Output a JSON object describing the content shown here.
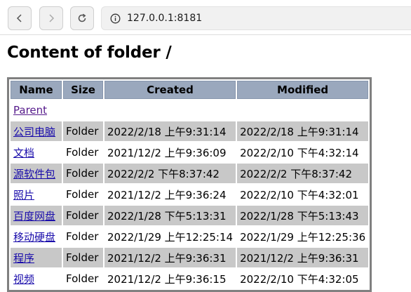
{
  "browser": {
    "url": "127.0.0.1:8181"
  },
  "page": {
    "title": "Content of folder /"
  },
  "table": {
    "headers": {
      "name": "Name",
      "size": "Size",
      "created": "Created",
      "modified": "Modified"
    },
    "parent_link": "Parent",
    "rows": [
      {
        "name": "公司电脑",
        "size": "Folder",
        "created": "2022/2/18 上午9:31:14",
        "modified": "2022/2/18 上午9:31:14"
      },
      {
        "name": "文档",
        "size": "Folder",
        "created": "2021/12/2 上午9:36:09",
        "modified": "2022/2/10 下午4:32:14"
      },
      {
        "name": "源软件包",
        "size": "Folder",
        "created": "2022/2/2 下午8:37:42",
        "modified": "2022/2/2 下午8:37:42"
      },
      {
        "name": "照片",
        "size": "Folder",
        "created": "2021/12/2 上午9:36:24",
        "modified": "2022/2/10 下午4:32:01"
      },
      {
        "name": "百度网盘",
        "size": "Folder",
        "created": "2022/1/28 下午5:13:31",
        "modified": "2022/1/28 下午5:13:43"
      },
      {
        "name": "移动硬盘",
        "size": "Folder",
        "created": "2022/1/29 上午12:25:14",
        "modified": "2022/1/29 上午12:25:36"
      },
      {
        "name": "程序",
        "size": "Folder",
        "created": "2021/12/2 上午9:36:31",
        "modified": "2021/12/2 上午9:36:31"
      },
      {
        "name": "视频",
        "size": "Folder",
        "created": "2021/12/2 上午9:36:15",
        "modified": "2022/2/10 下午4:32:05"
      }
    ]
  }
}
